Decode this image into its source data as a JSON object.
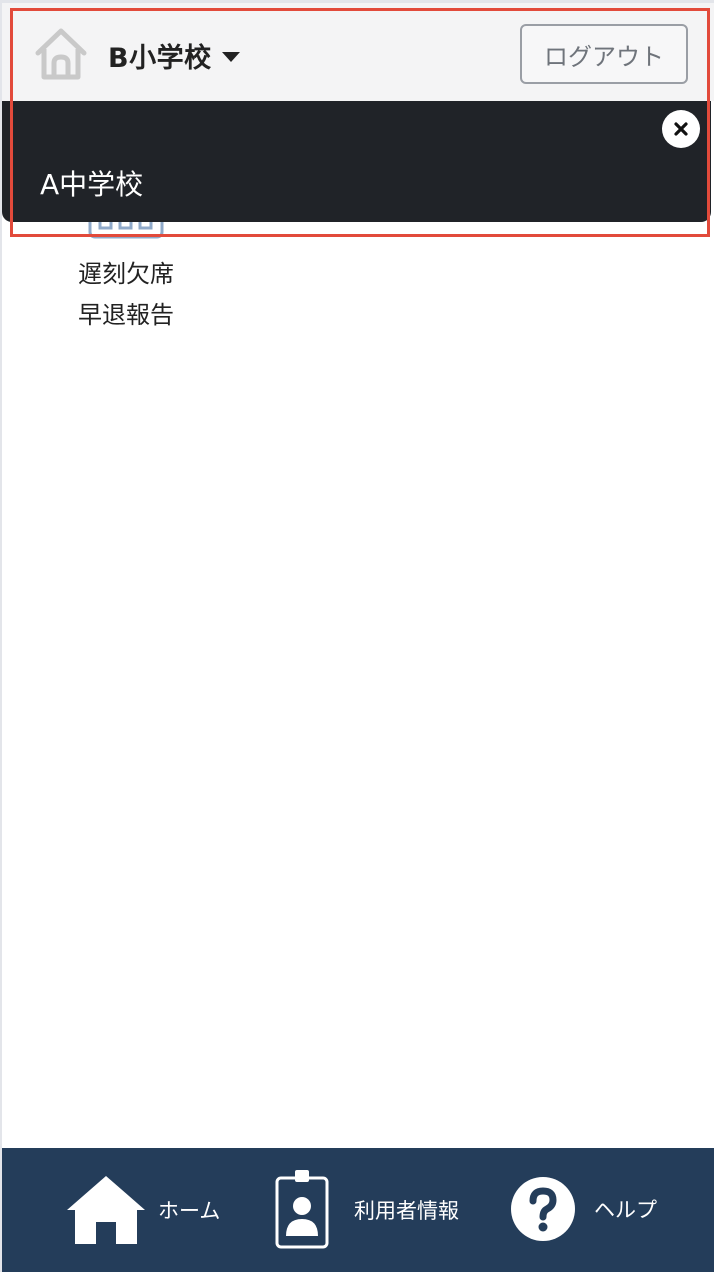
{
  "header": {
    "selected_school": "B小学校",
    "logout_label": "ログアウト"
  },
  "dropdown": {
    "items": [
      {
        "label": "A中学校"
      }
    ]
  },
  "main": {
    "tiles": [
      {
        "label_line1": "遅刻欠席",
        "label_line2": "早退報告",
        "icon": "calendar-icon"
      }
    ]
  },
  "bottom_nav": {
    "items": [
      {
        "label": "ホーム",
        "icon": "home-icon"
      },
      {
        "label": "利用者情報",
        "icon": "id-badge-icon"
      },
      {
        "label": "ヘルプ",
        "icon": "question-circle-icon"
      }
    ]
  },
  "colors": {
    "header_bg": "#f4f4f5",
    "dropdown_bg": "#202328",
    "nav_bg": "#243d5a",
    "highlight": "#e24a3b"
  }
}
